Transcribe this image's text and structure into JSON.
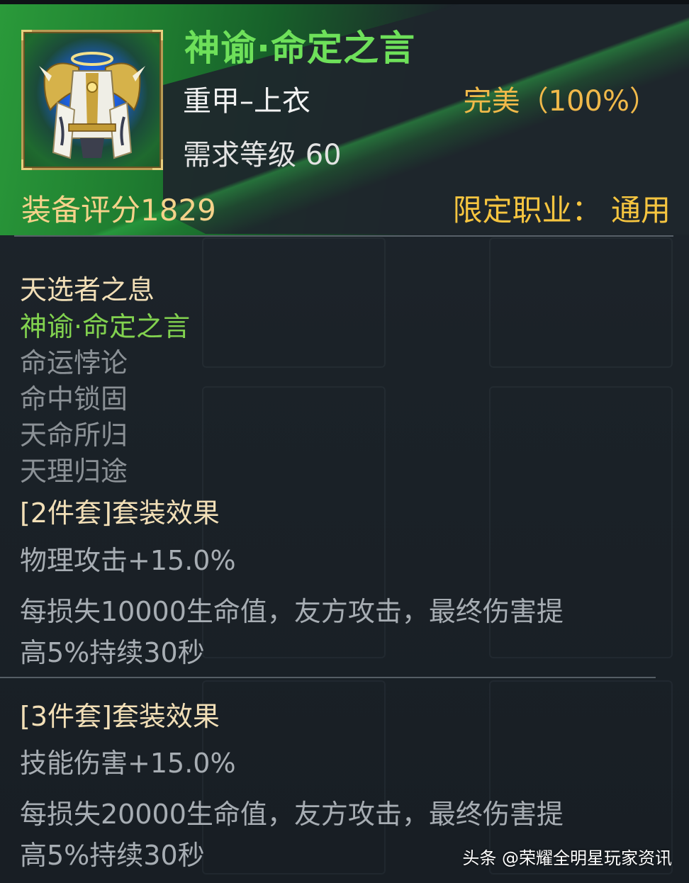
{
  "item": {
    "name": "神谕·命定之言",
    "type": "重甲–上衣",
    "quality": "完美（100%）",
    "level_label": "需求等级 60",
    "score_label": "装备评分1829",
    "class_label": "限定职业：  通用"
  },
  "set": {
    "name": "天选者之息",
    "pieces": [
      {
        "name": "神谕·命定之言",
        "owned": true
      },
      {
        "name": "命运悖论",
        "owned": false
      },
      {
        "name": "命中锁固",
        "owned": false
      },
      {
        "name": "天命所归",
        "owned": false
      },
      {
        "name": "天理归途",
        "owned": false
      }
    ]
  },
  "effects": [
    {
      "title": "[2件套]套装效果",
      "stat": "物理攻击+15.0%",
      "desc_line1": "每损失10000生命值，友方攻击，最终伤害提",
      "desc_line2": "高5%持续30秒"
    },
    {
      "title": "[3件套]套装效果",
      "stat": "技能伤害+15.0%",
      "desc_line1": "每损失20000生命值，友方攻击，最终伤害提",
      "desc_line2": "高5%持续30秒"
    }
  ],
  "watermark": "头条 @荣耀全明星玩家资讯",
  "colors": {
    "title_green": "#6ee05a",
    "quality_gold": "#f0b94a",
    "owned_piece": "#82d24f",
    "missing_piece": "#8b9196"
  },
  "icon": "armor-chestplate-icon"
}
